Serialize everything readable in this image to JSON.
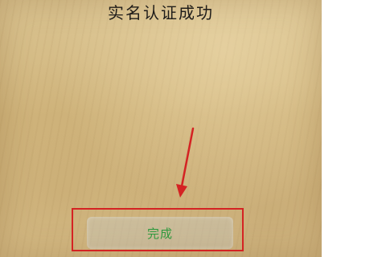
{
  "dialog": {
    "title": "实名认证成功",
    "finish_button_label": "完成"
  },
  "annotation": {
    "highlight_color": "#d42323",
    "arrow_color": "#d42323"
  },
  "colors": {
    "background": "#d6bd88",
    "title_text": "#1a1a1a",
    "button_text": "#2e9b3f"
  }
}
